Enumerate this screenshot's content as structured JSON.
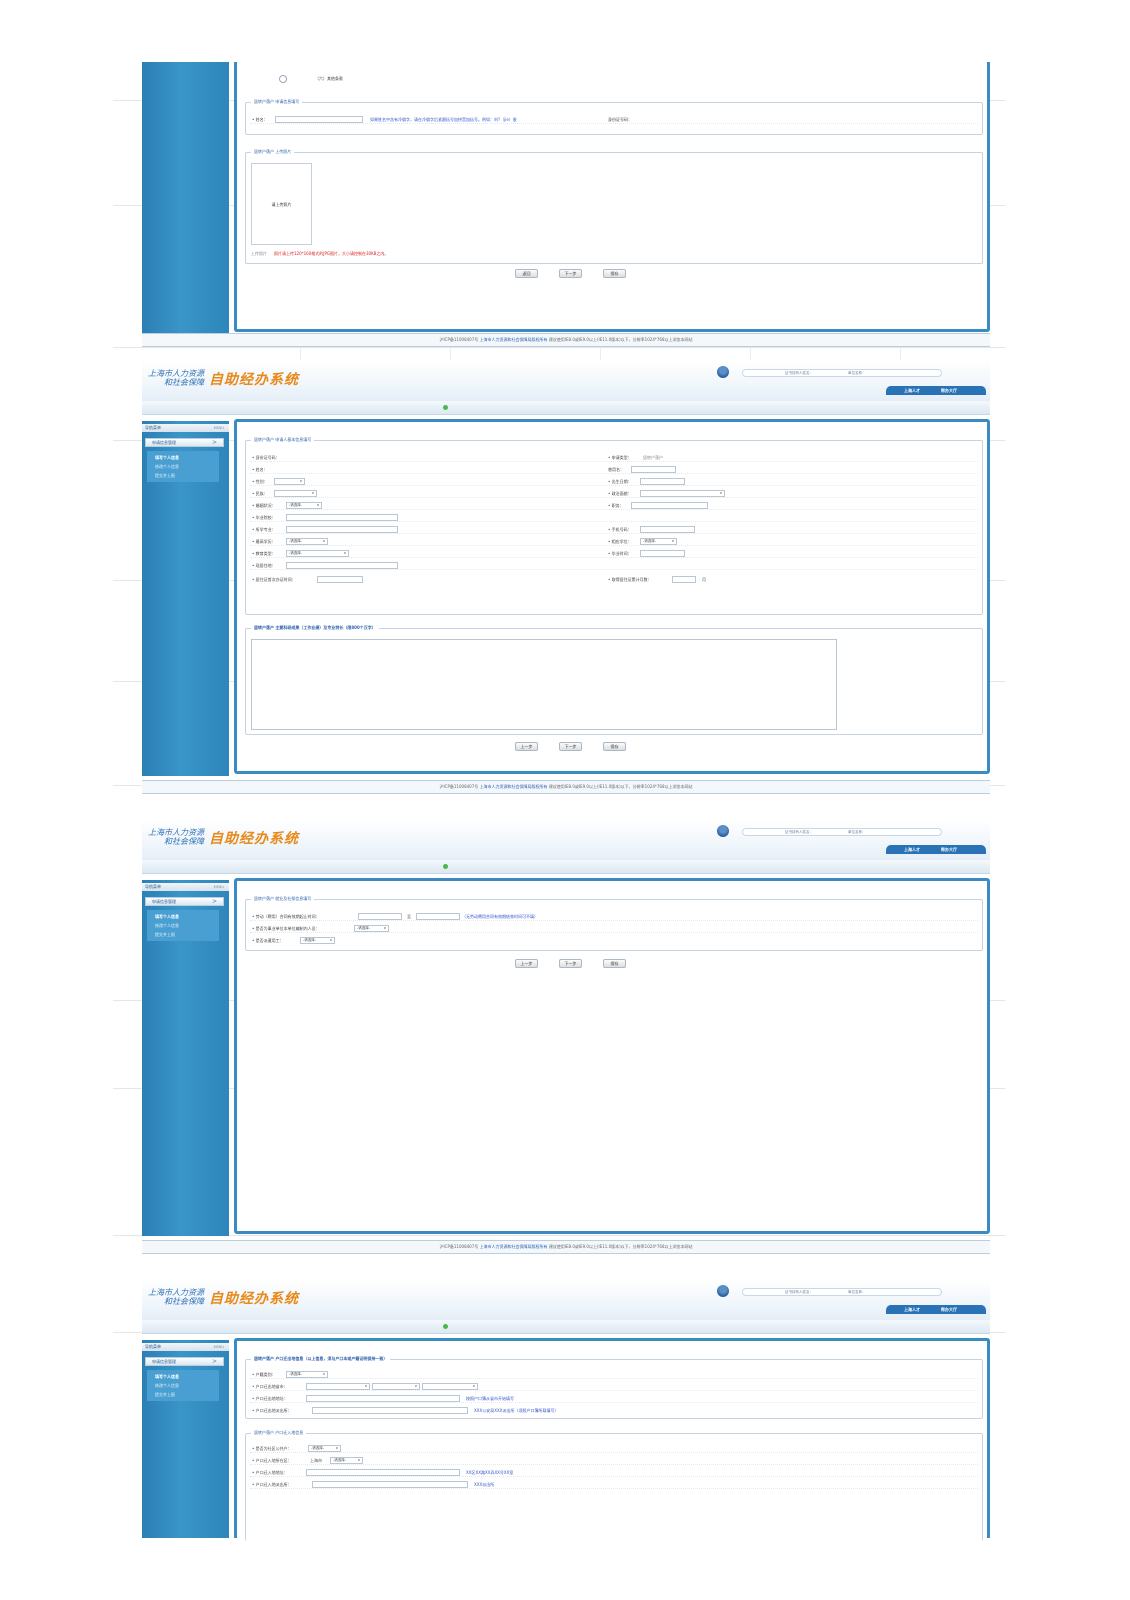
{
  "header": {
    "logo_line1": "上海市人力资源",
    "logo_line2": "和社会保障",
    "logo_big": "自助经办系统",
    "login_a": "证书持有人姓名：",
    "login_b": "单位名称：",
    "tab1": "上海人才",
    "tab2": "帮办大厅"
  },
  "nav": {
    "title": "导航菜单",
    "title_en": "MENU",
    "group": "申请信息管理",
    "group_arrow": ">",
    "items": [
      "填写个人信息",
      "修改个人信息",
      "提交并上报"
    ]
  },
  "footer": {
    "icp": "沪ICP备11008407号",
    "owner": "上海市人力资源和社会保障局版权所有",
    "browser_note": "建议使用IE8.0或IE9.0以上(IE11.0版本)以下，分辨率1024*768以上浏览本网站"
  },
  "page1": {
    "radio_label": "（六）其他条款",
    "section_apply_legend": "居转户落户 申请信息填写",
    "name_label": "• 姓名：",
    "name_hint": "如果姓名中含有冷僻字，请在冷僻字后紧跟括号加拼音加括号。例如：刘?（jie）俊",
    "id_label": "身份证号码：",
    "section_photo_legend": "居转户落户 上传照片",
    "photo_placeholder": "请上传照片",
    "photo_field_label": "上传照片",
    "photo_note": "照片请上传120*160格式的JPG图片，大小请控制在30KB之内。",
    "btn_back": "返回",
    "btn_next": "下一步",
    "btn_save": "保存"
  },
  "page2": {
    "section_basic_legend": "居转户落户 申请人基本信息填写",
    "id_label": "• 身份证号码：",
    "apply_type_label": "• 申请类型：",
    "apply_type_value": "居转户落户",
    "name_label": "• 姓名：",
    "former_name_label": "曾用名：",
    "gender_label": "• 性别：",
    "birth_label": "• 出生日期：",
    "ethnic_label": "• 民族：",
    "political_label": "• 政治面貌：",
    "marital_label": "• 婚姻状况：",
    "marital_value": "-请选择-",
    "title_label": "• 职务：",
    "school_label": "• 毕业院校：",
    "major_label": "• 所学专业：",
    "phone_label": "• 手机号码：",
    "edu_label": "• 最高学历：",
    "edu_value": "-请选择-",
    "degree_label": "• 相应学位：",
    "degree_value": "-请选择-",
    "edu_type_label": "• 教育类型：",
    "edu_type_value": "-请选择-",
    "grad_time_label": "• 毕业时间：",
    "residence_label": "• 现居住地：",
    "permit_first_label": "• 居住证首次办证时间：",
    "permit_months_label": "• 取得居住证累计月数：",
    "permit_months_unit": "月",
    "section_resume_legend": "居转户落户 主要科研成果（工作业绩）及专业特长（限800个汉字）",
    "btn_prev": "上一步",
    "btn_next": "下一步",
    "btn_save": "保存"
  },
  "page3": {
    "section_legend": "居转户落户 就业及社保信息填写",
    "contract_label": "• 劳动（聘用）合同有效期起止时间：",
    "contract_to": "至",
    "contract_hint": "（无劳动聘用合同有效期结束时间可不填）",
    "staff_label": "• 是否为事业单位本单位编制内人员：",
    "staff_value": "-请选择-",
    "dispatch_label": "• 是否派遣用工：",
    "dispatch_value": "-请选择-",
    "btn_prev": "上一步",
    "btn_next": "下一步",
    "btn_save": "保存"
  },
  "page4": {
    "section_out_legend": "居转户落户 户口迁出地信息（以上信息，须与户口本或户籍证明保持一致）",
    "hukou_type_label": "• 户籍类别：",
    "hukou_type_value": "-请选择-",
    "out_city_label": "• 户口迁出地省市：",
    "out_addr_label": "• 户口迁出地地址：",
    "out_addr_hint": "按照户口簿从省市开始填写",
    "out_police_label": "• 户口迁出地派出所：",
    "out_police_hint": "XXX公安局XXX派出所（须照户口簿所载填写）",
    "section_in_legend": "居转户落户 户口迁入地信息",
    "community_label": "• 是否为社区公共户：",
    "community_value": "-请选择-",
    "in_district_label": "• 户口迁入地所在区：",
    "in_district_city": "上海市",
    "in_district_value": "-请选择-",
    "in_addr_label": "• 户口迁入地地址：",
    "in_addr_hint": "XX区XX路XX弄XX号XX室",
    "in_police_label": "• 户口迁入地派出所：",
    "in_police_hint": "XXX派出所"
  }
}
